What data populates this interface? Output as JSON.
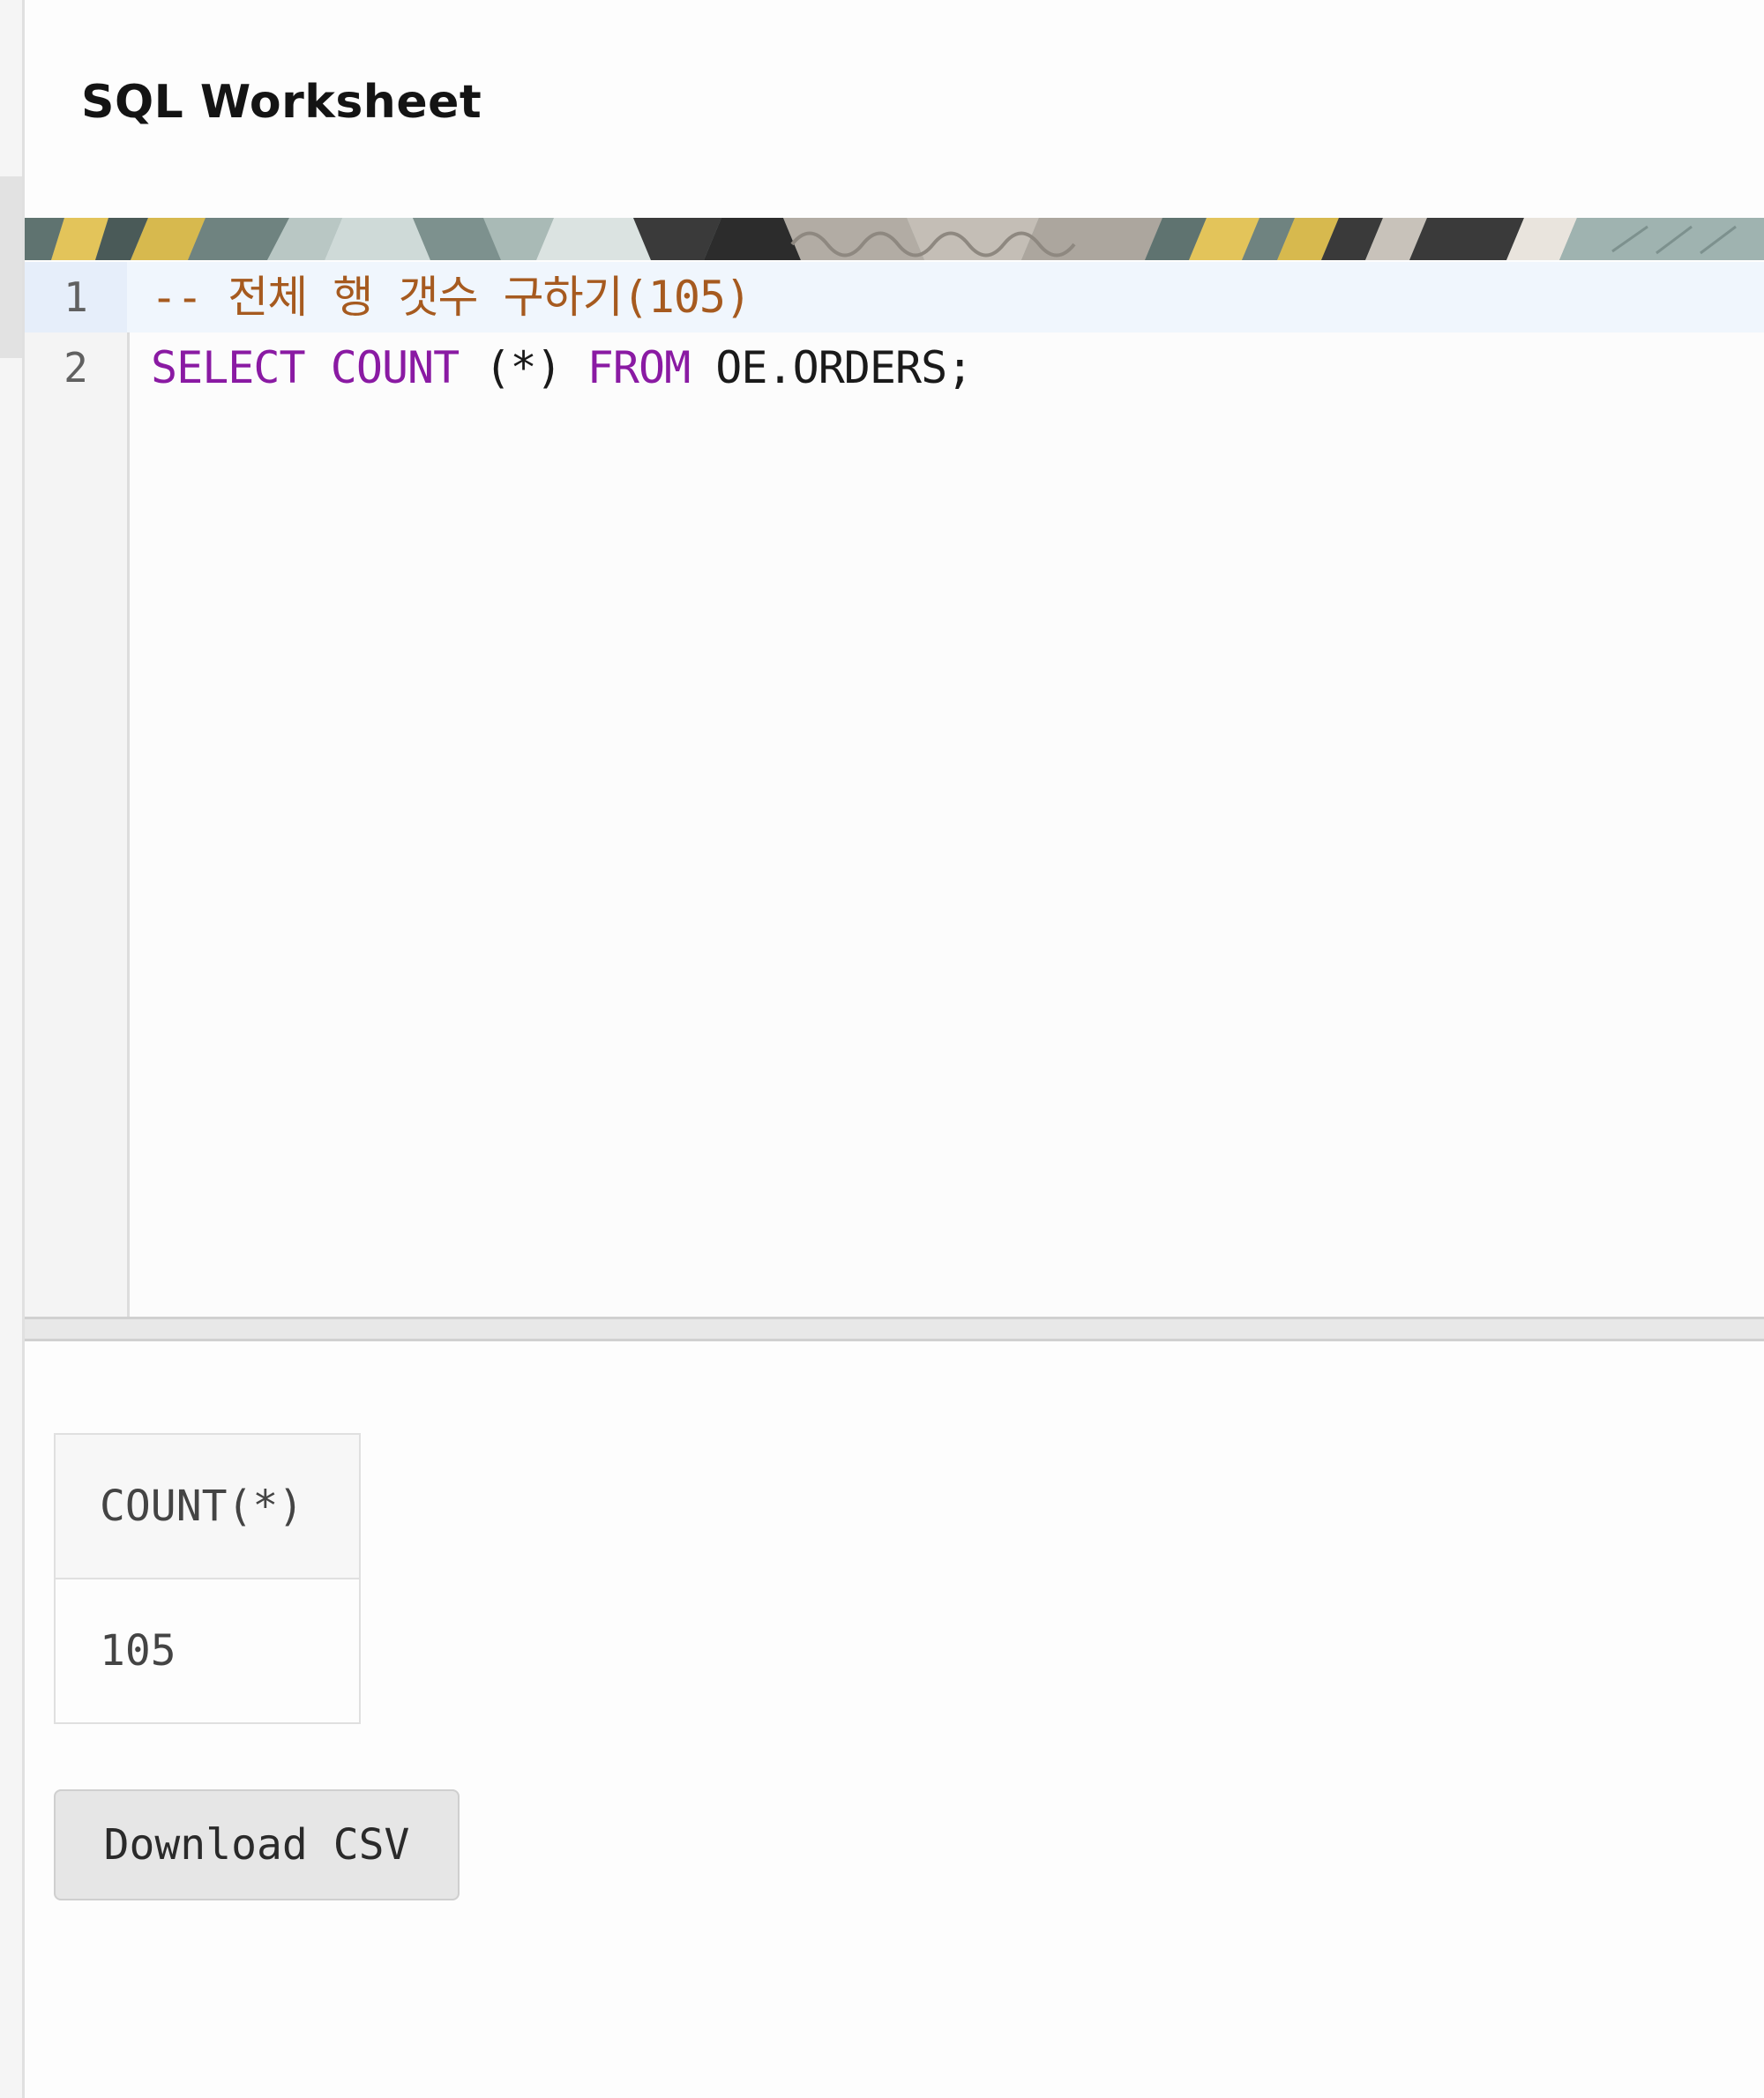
{
  "page": {
    "title": "SQL Worksheet"
  },
  "editor": {
    "lines": [
      {
        "number": "1",
        "tokens": [
          {
            "type": "comment",
            "text": "-- 전체 행 갯수 구하기(105)"
          }
        ]
      },
      {
        "number": "2",
        "tokens": [
          {
            "type": "keyword",
            "text": "SELECT"
          },
          {
            "type": "plain",
            "text": " "
          },
          {
            "type": "keyword",
            "text": "COUNT"
          },
          {
            "type": "plain",
            "text": " (*) "
          },
          {
            "type": "keyword",
            "text": "FROM"
          },
          {
            "type": "plain",
            "text": " OE.ORDERS;"
          }
        ]
      }
    ],
    "colors": {
      "comment": "#a65a1f",
      "keyword": "#8a1aa3",
      "plain": "#1a1a1a",
      "active_line": "#f0f6fd"
    }
  },
  "results": {
    "columns": [
      "COUNT(*)"
    ],
    "rows": [
      [
        "105"
      ]
    ],
    "download_label": "Download CSV"
  }
}
